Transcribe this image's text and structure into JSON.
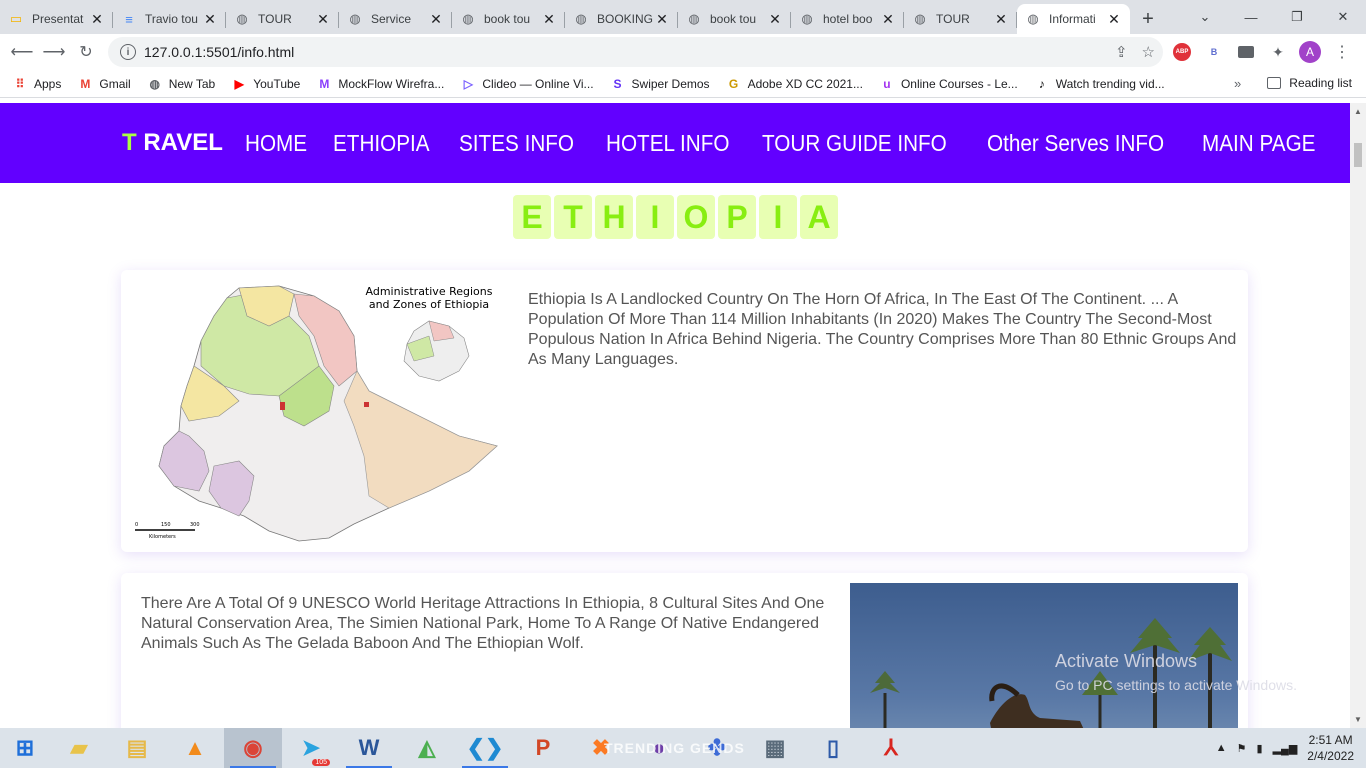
{
  "browser": {
    "tabs": [
      {
        "title": "Presentat",
        "icon": "slides-icon"
      },
      {
        "title": "Travio tou",
        "icon": "docs-icon"
      },
      {
        "title": "TOUR",
        "icon": "globe-icon"
      },
      {
        "title": "Service",
        "icon": "globe-icon"
      },
      {
        "title": "book tou",
        "icon": "globe-icon"
      },
      {
        "title": "BOOKING",
        "icon": "globe-icon"
      },
      {
        "title": "book tou",
        "icon": "globe-icon"
      },
      {
        "title": "hotel boo",
        "icon": "globe-icon"
      },
      {
        "title": "TOUR",
        "icon": "globe-icon"
      },
      {
        "title": "Informati",
        "icon": "globe-icon",
        "active": true
      }
    ],
    "url": "127.0.0.1:5501/info.html",
    "bookmarks": [
      {
        "label": "Apps",
        "icon": "apps-grid-icon"
      },
      {
        "label": "Gmail",
        "icon": "gmail-icon"
      },
      {
        "label": "New Tab",
        "icon": "globe-icon"
      },
      {
        "label": "YouTube",
        "icon": "youtube-icon"
      },
      {
        "label": "MockFlow Wirefra...",
        "icon": "mockflow-icon"
      },
      {
        "label": "Clideo — Online Vi...",
        "icon": "clideo-icon"
      },
      {
        "label": "Swiper Demos",
        "icon": "swiper-icon"
      },
      {
        "label": "Adobe XD CC 2021...",
        "icon": "gexpert-icon"
      },
      {
        "label": "Online Courses - Le...",
        "icon": "udemy-icon"
      },
      {
        "label": "Watch trending vid...",
        "icon": "tiktok-icon"
      }
    ],
    "more_bookmarks": "»",
    "reading_list": "Reading list",
    "profile_initial": "A",
    "ext_abp": "ABP",
    "ext_b": "B"
  },
  "site": {
    "brand_initial": "T",
    "brand_rest": " RAVEL",
    "nav": [
      "HOME",
      "ETHIOPIA",
      "SITES INFO",
      "HOTEL INFO",
      "TOUR GUIDE INFO",
      "Other Serves INFO",
      "MAIN PAGE"
    ],
    "heading_letters": [
      "E",
      "T",
      "H",
      "I",
      "O",
      "P",
      "I",
      "A"
    ],
    "card1_text": "Ethiopia Is A Landlocked Country On The Horn Of Africa, In The East Of The Continent. ... A Population Of More Than 114 Million Inhabitants (In 2020) Makes The Country The Second-Most Populous Nation In Africa Behind Nigeria. The Country Comprises More Than 80 Ethnic Groups And As Many Languages.",
    "map_title_line1": "Administrative Regions",
    "map_title_line2": "and Zones of Ethiopia",
    "map_scale_0": "0",
    "map_scale_150": "150",
    "map_scale_300": "300",
    "map_scale_unit": "Kilometers",
    "card2_text": "There Are A Total Of 9 UNESCO World Heritage Attractions In Ethiopia, 8 Cultural Sites And One Natural Conservation Area, The Simien National Park, Home To A Range Of Native Endangered Animals Such As The Gelada Baboon And The Ethiopian Wolf."
  },
  "watermark": {
    "line1": "Activate Windows",
    "line2": "Go to PC settings to activate Windows."
  },
  "taskbar": {
    "apps": [
      "windows-start-icon",
      "file-manager-icon",
      "explorer-icon",
      "vlc-icon",
      "chrome-icon",
      "telegram-icon",
      "word-icon",
      "tor-icon",
      "vscode-icon",
      "powerpoint-icon",
      "xampp-icon",
      "github-icon",
      "network-icon",
      "calculator-icon",
      "reader-icon",
      "acrobat-icon"
    ],
    "telegram_badge": "105",
    "behind_text": "TRENDING GENDS",
    "time": "2:51 AM",
    "date": "2/4/2022"
  },
  "colors": {
    "navbar": "#6200ff",
    "brand_accent": "#aaff44",
    "letter_bg": "#e8ffb3",
    "letter_fg": "#88ee11"
  }
}
